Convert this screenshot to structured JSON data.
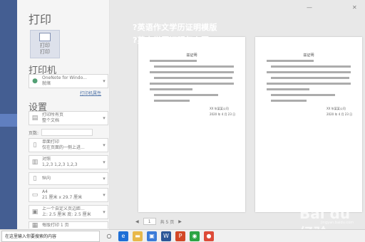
{
  "caption": {
    "line1": "?英语作文学历证明模版",
    "line2": "?英文学历证明怎么写?"
  },
  "panel": {
    "title": "打印",
    "print_button": {
      "line1": "打印",
      "line2": "打印"
    },
    "printer_section": "打印机",
    "printer": {
      "name": "OneNote for Windo...",
      "status": "就绪"
    },
    "printer_properties": "打印机属性",
    "settings_section": "设置",
    "range": {
      "line1": "打印所有页",
      "line2": "整个文档"
    },
    "pages_label": "页数:",
    "sides": {
      "line1": "单面打印",
      "line2": "仅在页面的一侧上进..."
    },
    "collate": {
      "line1": "对照",
      "line2": "1,2,3    1,2,3    1,2,3"
    },
    "orientation": {
      "line1": "纵向"
    },
    "paper": {
      "line1": "A4",
      "line2": "21 厘米 x 29.7 厘米"
    },
    "margins": {
      "line1": "上一个自定义页边距...",
      "line2": "上: 2.5 厘米 底: 2.5 厘米"
    },
    "per_sheet": {
      "line1": "每版打印 1 页"
    }
  },
  "preview": {
    "page_input": "1",
    "page_total": "共 5 页"
  },
  "sheets": [
    {
      "title": "兹证明",
      "date_line": "XX 年某某公司",
      "date2": "2020 年 4 月 23 日"
    },
    {
      "title": "兹证明",
      "date_line": "XX 年某某公司",
      "date2": "2020 年 4 月 23 日"
    }
  ],
  "watermark": {
    "text": "Bai du 经验",
    "sub": "jingyan.baidu.com"
  },
  "taskbar": {
    "search_text": "在这里输入你要搜索的内容"
  },
  "icons": {
    "window": [
      "minimize-icon",
      "close-icon"
    ],
    "taskbar": [
      "start-icon",
      "task-view-icon",
      "edge-icon",
      "folder-icon",
      "store-icon",
      "word-icon",
      "powerpoint-icon",
      "wechat-icon",
      "chrome-icon"
    ]
  }
}
